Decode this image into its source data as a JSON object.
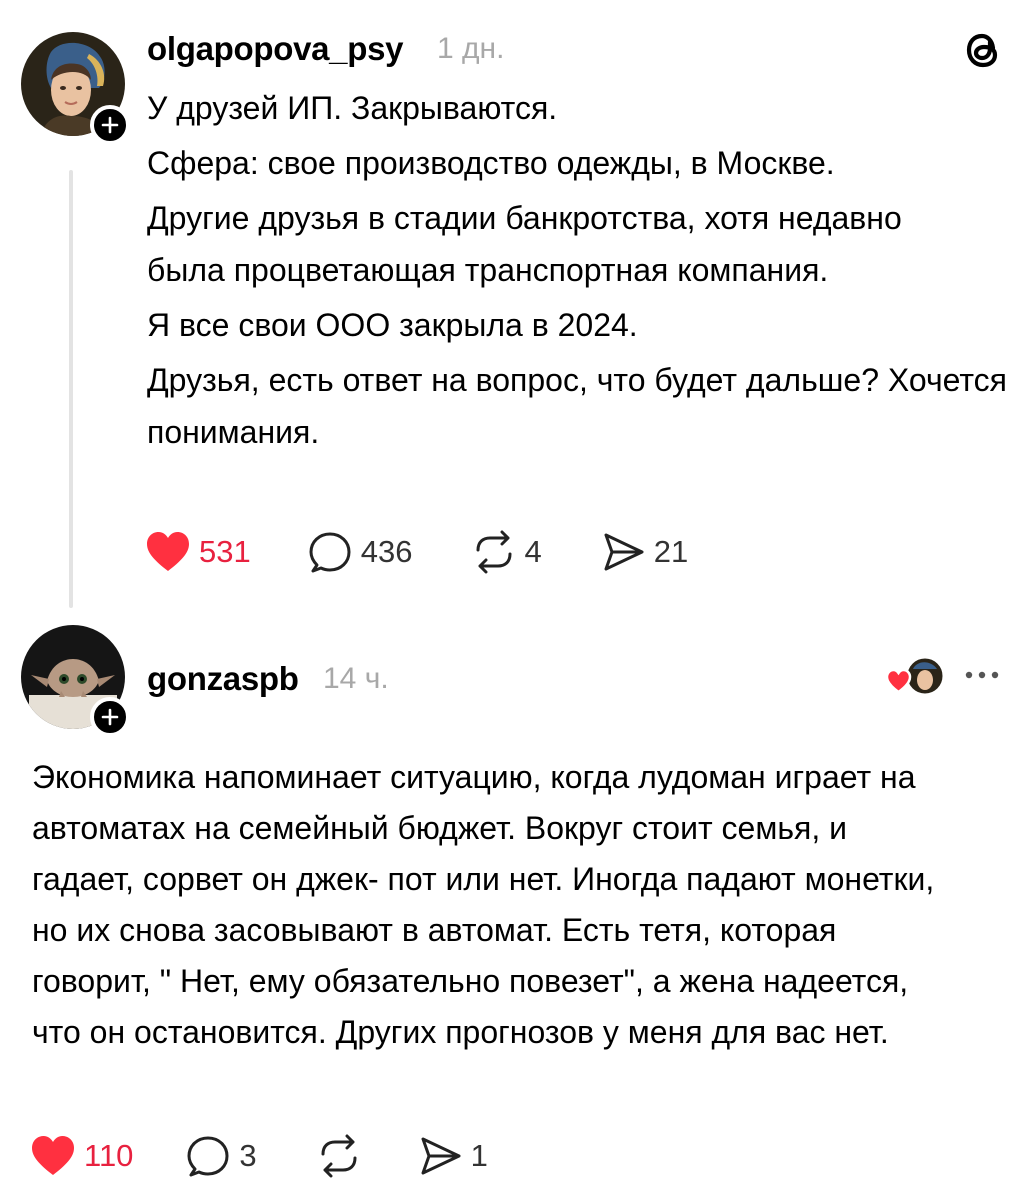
{
  "post1": {
    "username": "olgapopova_psy",
    "timestamp": "1 дн.",
    "paragraphs": [
      "У друзей ИП. Закрываются.",
      "Сфера: свое производство одежды, в Москве.",
      "Другие друзья в стадии банкротства,  хотя недавно была процветающая транспортная компания.",
      "Я все свои ООО закрыла в 2024.",
      "Друзья, есть ответ на вопрос, что будет дальше? Хочется понимания."
    ],
    "likes": "531",
    "comments": "436",
    "reposts": "4",
    "shares": "21"
  },
  "post2": {
    "username": "gonzaspb",
    "timestamp": "14 ч.",
    "text": "Экономика напоминает ситуацию, когда лудоман играет на автоматах на семейный бюджет. Вокруг стоит семья, и гадает, сорвет он джек- пот или нет. Иногда падают монетки, но их снова засовывают в автомат. Есть тетя, которая говорит, \" Нет, ему обязательно повезет\", а жена надеется, что он остановится. Других прогнозов у меня для вас нет.",
    "likes": "110",
    "comments": "3",
    "shares": "1"
  },
  "icons": {
    "logo": "threads-logo-icon",
    "like": "heart-icon",
    "comment": "comment-bubble-icon",
    "repost": "repost-icon",
    "share": "send-icon",
    "more": "more-icon",
    "follow": "plus-icon"
  },
  "colors": {
    "like_red": "#ff3040",
    "secondary_text": "#a8a8a8",
    "thread_line": "#e3e3e3"
  }
}
